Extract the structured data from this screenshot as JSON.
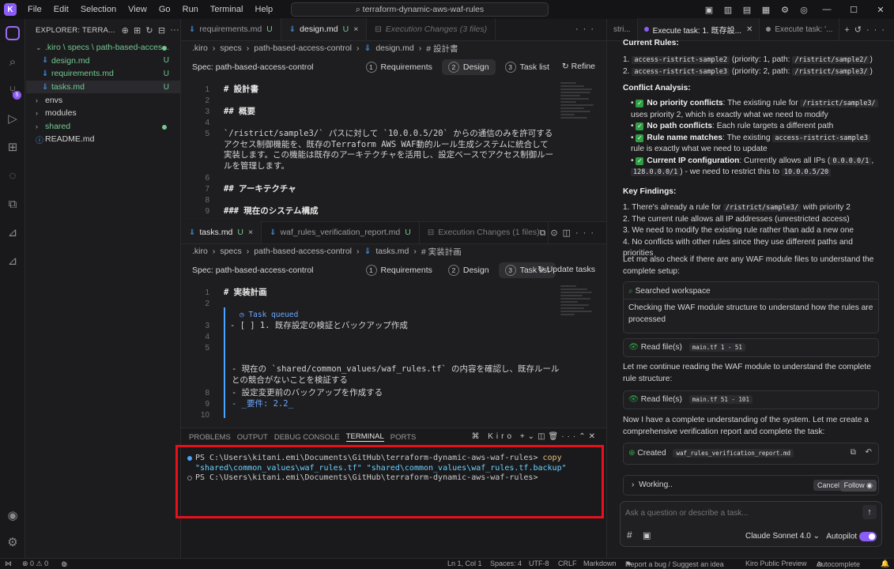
{
  "titlebar": {
    "menu": [
      "File",
      "Edit",
      "Selection",
      "View",
      "Go",
      "Run",
      "Terminal",
      "Help"
    ],
    "search": "terraform-dynamic-aws-waf-rules"
  },
  "explorer": {
    "title": "EXPLORER: TERRA...",
    "items": [
      {
        "label": ".kiro \\ specs \\ path-based-acces...",
        "depth": 0,
        "chev": "⌄",
        "status": "dot"
      },
      {
        "label": "design.md",
        "depth": 1,
        "status": "U"
      },
      {
        "label": "requirements.md",
        "depth": 1,
        "status": "U"
      },
      {
        "label": "tasks.md",
        "depth": 1,
        "status": "U"
      },
      {
        "label": "envs",
        "depth": 0,
        "chev": "›",
        "status": ""
      },
      {
        "label": "modules",
        "depth": 0,
        "chev": "›",
        "status": ""
      },
      {
        "label": "shared",
        "depth": 0,
        "chev": "›",
        "status": "dot"
      },
      {
        "label": "README.md",
        "depth": 0,
        "status": ""
      }
    ]
  },
  "top_editor": {
    "tabs": [
      {
        "label": "requirements.md",
        "status": "U"
      },
      {
        "label": "design.md",
        "status": "U",
        "close": "×"
      },
      {
        "label": "Execution Changes (3 files)",
        "status": ""
      }
    ],
    "breadcrumb": [
      ".kiro",
      "›",
      "specs",
      "›",
      "path-based-access-control",
      "›",
      "design.md",
      "›",
      "# 設計書"
    ],
    "spec_label": "Spec: path-based-access-control",
    "steps": [
      {
        "n": "1",
        "label": "Requirements"
      },
      {
        "n": "2",
        "label": "Design"
      },
      {
        "n": "3",
        "label": "Task list"
      }
    ],
    "action": "Refine",
    "lines": [
      {
        "n": "1",
        "text": "# 設計書",
        "h": true
      },
      {
        "n": "2",
        "text": ""
      },
      {
        "n": "3",
        "text": "## 概要",
        "h": true
      },
      {
        "n": "4",
        "text": ""
      },
      {
        "n": "5",
        "text": "`/ristrict/sample3/` パスに対して `10.0.0.5/20` からの通信のみを許可するアクセス制御機能を、既存のTerraform AWS WAF動的ルール生成システムに統合して実装します。この機能は既存のアーキテクチャを活用し、設定ベースでアクセス制御ルールを管理します。"
      },
      {
        "n": "6",
        "text": ""
      },
      {
        "n": "7",
        "text": "## アーキテクチャ",
        "h": true
      },
      {
        "n": "8",
        "text": ""
      },
      {
        "n": "9",
        "text": "### 現在のシステム構成",
        "h": true
      }
    ]
  },
  "bottom_editor": {
    "tabs": [
      {
        "label": "tasks.md",
        "status": "U",
        "close": "×"
      },
      {
        "label": "waf_rules_verification_report.md",
        "status": "U"
      },
      {
        "label": "Execution Changes (1 files)",
        "status": ""
      }
    ],
    "breadcrumb": [
      ".kiro",
      "›",
      "specs",
      "›",
      "path-based-access-control",
      "›",
      "tasks.md",
      "›",
      "# 実装計画"
    ],
    "spec_label": "Spec: path-based-access-control",
    "steps": [
      {
        "n": "1",
        "label": "Requirements"
      },
      {
        "n": "2",
        "label": "Design"
      },
      {
        "n": "3",
        "label": "Task list"
      }
    ],
    "action": "Update tasks",
    "task_queued": "Task queued",
    "lines": [
      {
        "n": "1",
        "text": "# 実装計画",
        "h": true
      },
      {
        "n": "2",
        "text": ""
      },
      {
        "n": "3",
        "text": "- [ ] 1. 既存設定の検証とバックアップ作成"
      },
      {
        "n": "4",
        "text": ""
      },
      {
        "n": "5",
        "text": ""
      },
      {
        "n": "",
        "text": "- 現在の `shared/common_values/waf_rules.tf` の内容を確認し、既存ルールとの競合がないことを検証する"
      },
      {
        "n": "8",
        "text": "- 設定変更前のバックアップを作成する"
      },
      {
        "n": "9",
        "text": "- _要件: 2.2_"
      },
      {
        "n": "10",
        "text": ""
      }
    ]
  },
  "panel": {
    "tabs": [
      "PROBLEMS",
      "OUTPUT",
      "DEBUG CONSOLE",
      "TERMINAL",
      "PORTS"
    ],
    "active_tab": "TERMINAL",
    "shell": "Kiro",
    "terminal": {
      "prompt1": "PS C:\\Users\\kitani.emi\\Documents\\GitHub\\terraform-dynamic-aws-waf-rules>",
      "cmd": "copy",
      "arg1": "\"shared\\common_values\\waf_rules.tf\"",
      "arg2": "\"shared\\common_values\\waf_rules.tf.backup\"",
      "prompt2": "PS C:\\Users\\kitani.emi\\Documents\\GitHub\\terraform-dynamic-aws-waf-rules>"
    }
  },
  "chat": {
    "tabs": [
      {
        "label": "stri..."
      },
      {
        "label": "Execute task: 1. 既存設..."
      },
      {
        "label": "Execute task: '..."
      }
    ],
    "current_rules_title": "Current Rules:",
    "rules": [
      {
        "name": "access-ristrict-sample2",
        "priority": "(priority: 1, path:",
        "path": "/ristrict/sample2/",
        "end": ")"
      },
      {
        "name": "access-ristrict-sample3",
        "priority": "(priority: 2, path:",
        "path": "/ristrict/sample3/",
        "end": ")"
      }
    ],
    "conflict_title": "Conflict Analysis:",
    "conflicts": [
      {
        "bold": "No priority conflicts",
        "text": ": The existing rule for",
        "code": "/ristrict/sample3/",
        "rest": "uses priority 2, which is exactly what we need to modify"
      },
      {
        "bold": "No path conflicts",
        "text": ": Each rule targets a different path",
        "code": "",
        "rest": ""
      },
      {
        "bold": "Rule name matches",
        "text": ": The existing",
        "code": "access-ristrict-sample3",
        "rest": "rule is exactly what we need to update"
      },
      {
        "bold": "Current IP configuration",
        "text": ": Currently allows all IPs (",
        "code": "0.0.0.0/1",
        "rest": ", ",
        "code2": "128.0.0.0/1",
        "rest2": ") - we need to restrict this to",
        "code3": "10.0.0.5/20"
      }
    ],
    "findings_title": "Key Findings:",
    "findings": [
      {
        "pre": "1. There's already a rule for",
        "code": "/ristrict/sample3/",
        "post": "with priority 2"
      },
      {
        "pre": "2. The current rule allows all IP addresses (unrestricted access)",
        "code": "",
        "post": ""
      },
      {
        "pre": "3. We need to modify the existing rule rather than add a new one",
        "code": "",
        "post": ""
      },
      {
        "pre": "4. No conflicts with other rules since they use different paths and priorities",
        "code": "",
        "post": ""
      }
    ],
    "msg1": "Let me also check if there are any WAF module files to understand the complete setup:",
    "searched": "Searched workspace",
    "searched_desc": "Checking the WAF module structure to understand how the rules are processed",
    "read1": "Read file(s)",
    "read1_chip": "main.tf 1 - 51",
    "msg2": "Let me continue reading the WAF module to understand the complete rule structure:",
    "read2": "Read file(s)",
    "read2_chip": "main.tf 51 - 101",
    "msg3": "Now I have a complete understanding of the system. Let me create a comprehensive verification report and complete the task:",
    "created": "Created",
    "created_chip": "waf_rules_verification_report.md",
    "working": "Working..",
    "cancel": "Cancel",
    "follow": "Follow",
    "ask_placeholder": "Ask a question or describe a task...",
    "model": "Claude Sonnet 4.0",
    "autopilot": "Autopilot"
  },
  "statusbar": {
    "left": "⊗ 0 ⚠ 0",
    "ports": "0",
    "position": "Ln 1, Col 1",
    "spaces": "Spaces: 4",
    "encoding": "UTF-8",
    "eol": "CRLF",
    "language": "Markdown",
    "report": "Report a bug / Suggest an idea",
    "kiro": "Kiro Public Preview",
    "autocomplete": "Autocomplete"
  }
}
